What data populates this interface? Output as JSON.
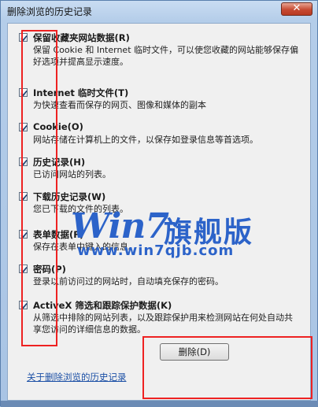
{
  "window": {
    "title": "删除浏览的历史记录",
    "close_glyph": "✕"
  },
  "options": [
    {
      "label": "保留收藏夹网站数据(R)",
      "description": "保留 Cookie 和 Internet 临时文件，可以使您收藏的网站能够保存偏好选项并提高显示速度。",
      "checked": true
    },
    {
      "label": "Internet 临时文件(T)",
      "description": "为快速查看而保存的网页、图像和媒体的副本",
      "checked": true
    },
    {
      "label": "Cookie(O)",
      "description": "网站存储在计算机上的文件，以保存如登录信息等首选项。",
      "checked": true
    },
    {
      "label": "历史记录(H)",
      "description": "已访问网站的列表。",
      "checked": true
    },
    {
      "label": "下载历史记录(W)",
      "description": "您已下载的文件的列表。",
      "checked": true
    },
    {
      "label": "表单数据(F)",
      "description": "保存在表单中键入的信息。",
      "checked": true
    },
    {
      "label": "密码(P)",
      "description": "登录以前访问过的网站时，自动填充保存的密码。",
      "checked": true
    },
    {
      "label": "ActiveX 筛选和跟踪保护数据(K)",
      "description": "从筛选中排除的网站列表，以及跟踪保护用来检测网站在何处自动共享您访问的详细信息的数据。",
      "checked": true
    }
  ],
  "footer": {
    "link_label": "关于删除浏览的历史记录",
    "delete_label": "删除(D)"
  },
  "watermark": {
    "brand": "Win7",
    "cn": "旗舰版",
    "url": "www.win7qjb.com"
  },
  "colors": {
    "annotation_red": "#e22222",
    "watermark_blue": "#2c63c9"
  }
}
